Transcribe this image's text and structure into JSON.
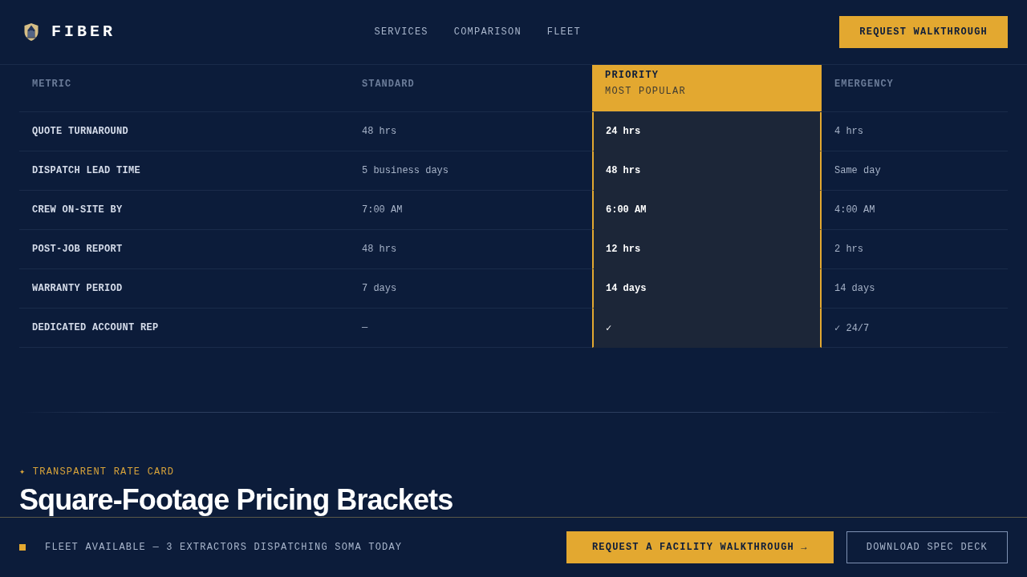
{
  "brand": {
    "name": "FIBER"
  },
  "nav": [
    {
      "label": "SERVICES"
    },
    {
      "label": "COMPARISON"
    },
    {
      "label": "FLEET"
    }
  ],
  "header_button": {
    "label": "REQUEST WALKTHROUGH"
  },
  "comparison": {
    "columns": [
      {
        "label": "METRIC",
        "highlighted": false
      },
      {
        "label": "STANDARD",
        "highlighted": false
      },
      {
        "label": "PRIORITY",
        "badge": "MOST POPULAR",
        "highlighted": true
      },
      {
        "label": "EMERGENCY",
        "highlighted": false
      }
    ],
    "rows": [
      {
        "metric": "QUOTE TURNAROUND",
        "values": [
          "48 hrs",
          "24 hrs",
          "4 hrs"
        ]
      },
      {
        "metric": "DISPATCH LEAD TIME",
        "values": [
          "5 business days",
          "48 hrs",
          "Same day"
        ]
      },
      {
        "metric": "CREW ON-SITE BY",
        "values": [
          "7:00 AM",
          "6:00 AM",
          "4:00 AM"
        ]
      },
      {
        "metric": "POST-JOB REPORT",
        "values": [
          "48 hrs",
          "12 hrs",
          "2 hrs"
        ]
      },
      {
        "metric": "WARRANTY PERIOD",
        "values": [
          "7 days",
          "14 days",
          "14 days"
        ]
      },
      {
        "metric": "DEDICATED ACCOUNT REP",
        "values": [
          "—",
          "✓",
          "✓ 24/7"
        ]
      }
    ]
  },
  "rate_card": {
    "eyebrow": "✦ TRANSPARENT RATE CARD",
    "title": "Square-Footage Pricing Brackets"
  },
  "bottom_bar": {
    "status": "FLEET AVAILABLE — 3 EXTRACTORS DISPATCHING SOMA TODAY",
    "buttons": [
      {
        "label": "REQUEST A FACILITY WALKTHROUGH →",
        "kind": "primary"
      },
      {
        "label": "DOWNLOAD SPEC DECK",
        "kind": "outline"
      }
    ]
  }
}
